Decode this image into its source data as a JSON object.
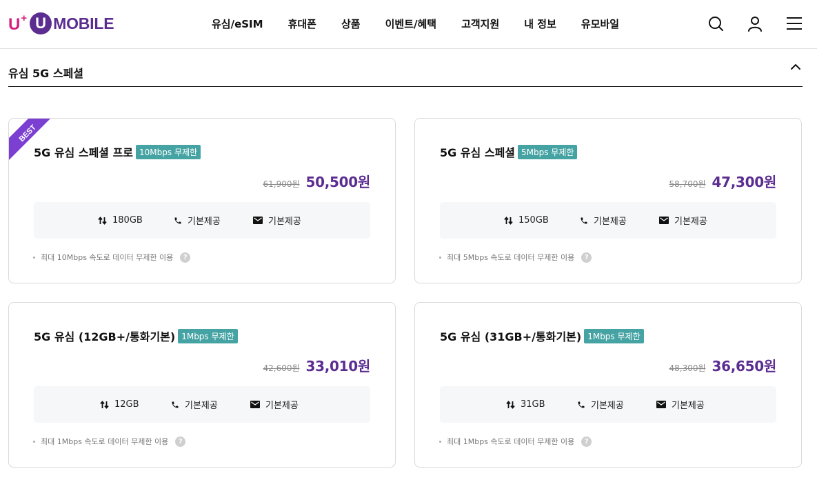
{
  "logo": {
    "u": "U",
    "plus": "+",
    "circle": "U",
    "text": "MOBILE"
  },
  "nav": [
    "유심/eSIM",
    "휴대폰",
    "상품",
    "이벤트/혜택",
    "고객지원",
    "내 정보",
    "유모바일"
  ],
  "header_icons": [
    "search-icon",
    "user-icon",
    "menu-icon"
  ],
  "section": {
    "title": "유심 5G 스페셜",
    "toggle_icon": "chevron-up-icon"
  },
  "best_label": "BEST",
  "cards": [
    {
      "name": "5G 유심 스페셜 프로",
      "badge": "10Mbps 무제한",
      "price_old": "61,900원",
      "price_new": "50,500원",
      "data": "180GB",
      "call": "기본제공",
      "sms": "기본제공",
      "note": "최대 10Mbps 속도로 데이터 무제한 이용",
      "best": true
    },
    {
      "name": "5G 유심 스페셜",
      "badge": "5Mbps 무제한",
      "price_old": "58,700원",
      "price_new": "47,300원",
      "data": "150GB",
      "call": "기본제공",
      "sms": "기본제공",
      "note": "최대 5Mbps 속도로 데이터 무제한 이용",
      "best": false
    },
    {
      "name": "5G 유심 (12GB+/통화기본)",
      "badge": "1Mbps 무제한",
      "price_old": "42,600원",
      "price_new": "33,010원",
      "data": "12GB",
      "call": "기본제공",
      "sms": "기본제공",
      "note": "최대 1Mbps 속도로 데이터 무제한 이용",
      "best": false
    },
    {
      "name": "5G 유심 (31GB+/통화기본)",
      "badge": "1Mbps 무제한",
      "price_old": "48,300원",
      "price_new": "36,650원",
      "data": "31GB",
      "call": "기본제공",
      "sms": "기본제공",
      "note": "최대 1Mbps 속도로 데이터 무제한 이용",
      "best": false
    }
  ],
  "help_symbol": "?",
  "colors": {
    "brand_purple": "#5c2d91",
    "brand_pink": "#d61f7c",
    "badge_teal": "#46a3a3",
    "best_ribbon": "#7b3fd1"
  }
}
